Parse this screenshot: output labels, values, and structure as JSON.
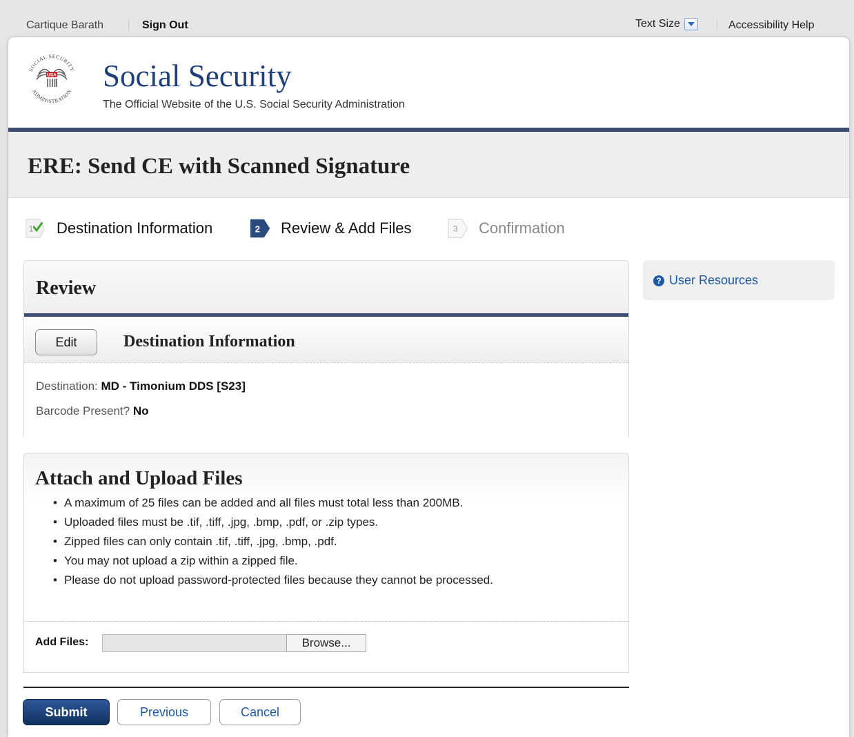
{
  "topbar": {
    "user_name": "Cartique Barath",
    "sign_out": "Sign Out",
    "text_size": "Text Size",
    "accessibility_help": "Accessibility Help"
  },
  "header": {
    "logo_top_text": "SOCIAL SECURITY",
    "logo_badge": "USA",
    "logo_bottom_text": "ADMINISTRATION",
    "title": "Social Security",
    "subtitle": "The Official Website of the U.S. Social Security Administration"
  },
  "page_title": "ERE: Send CE with Scanned Signature",
  "steps": [
    {
      "number": "1",
      "label": "Destination Information",
      "state": "complete"
    },
    {
      "number": "2",
      "label": "Review & Add Files",
      "state": "active"
    },
    {
      "number": "3",
      "label": "Confirmation",
      "state": "upcoming"
    }
  ],
  "review": {
    "title": "Review",
    "edit_label": "Edit",
    "section_title": "Destination Information",
    "destination_label": "Destination:",
    "destination_value": "MD - Timonium DDS [S23]",
    "barcode_label": "Barcode Present?",
    "barcode_value": "No"
  },
  "upload": {
    "title": "Attach and Upload Files",
    "rules": [
      "A maximum of 25 files can be added and all files must total less than 200MB.",
      "Uploaded files must be .tif, .tiff, .jpg, .bmp, .pdf, or .zip types.",
      "Zipped files can only contain .tif, .tiff, .jpg, .bmp, .pdf.",
      "You may not upload a zip within a zipped file.",
      "Please do not upload password-protected files because they cannot be processed."
    ],
    "add_files_label": "Add Files:",
    "file_value": "",
    "browse_label": "Browse..."
  },
  "actions": {
    "submit": "Submit",
    "previous": "Previous",
    "cancel": "Cancel"
  },
  "sidebar": {
    "resources_icon": "help-circle-icon",
    "resources_label": "User Resources"
  },
  "colors": {
    "brand_navy": "#3b4d73",
    "title_blue": "#1f3f7a",
    "link_blue": "#1d5aa6",
    "check_green": "#3aa52b",
    "submit_blue": "#11305f"
  }
}
